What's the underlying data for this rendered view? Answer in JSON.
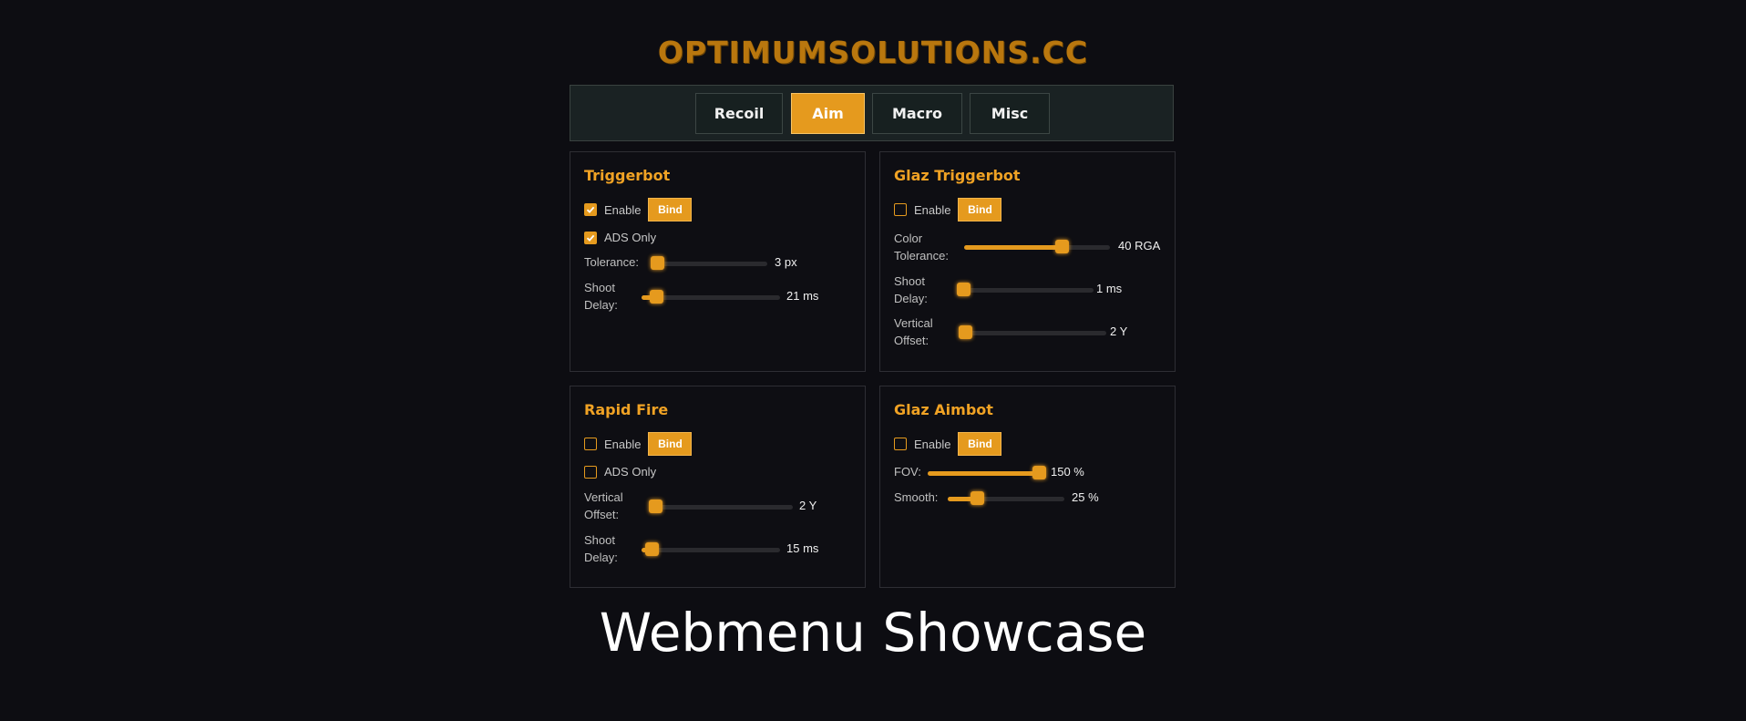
{
  "brand": "OPTIMUMSOLUTIONS.CC",
  "tabs": {
    "recoil": "Recoil",
    "aim": "Aim",
    "macro": "Macro",
    "misc": "Misc",
    "active": "Aim"
  },
  "triggerbot": {
    "title": "Triggerbot",
    "enable_label": "Enable",
    "enable_checked": true,
    "bind_label": "Bind",
    "ads_label": "ADS Only",
    "ads_checked": true,
    "tolerance": {
      "label": "Tolerance:",
      "value": 3,
      "max": 100,
      "display": "3 px"
    },
    "shoot_delay": {
      "label1": "Shoot",
      "label2": "Delay:",
      "value": 21,
      "max": 200,
      "display": "21 ms"
    }
  },
  "glaz_triggerbot": {
    "title": "Glaz Triggerbot",
    "enable_label": "Enable",
    "enable_checked": false,
    "bind_label": "Bind",
    "color_tolerance": {
      "label1": "Color",
      "label2": "Tolerance:",
      "value": 40,
      "max": 60,
      "display": "40 RGA"
    },
    "shoot_delay": {
      "label1": "Shoot",
      "label2": "Delay:",
      "value": 1,
      "max": 200,
      "display": "1 ms"
    },
    "vertical_offset": {
      "label1": "Vertical",
      "label2": "Offset:",
      "value": 2,
      "max": 50,
      "display": "2 Y"
    }
  },
  "rapid_fire": {
    "title": "Rapid Fire",
    "enable_label": "Enable",
    "enable_checked": false,
    "bind_label": "Bind",
    "ads_label": "ADS Only",
    "ads_checked": false,
    "vertical_offset": {
      "label1": "Vertical",
      "label2": "Offset:",
      "value": 2,
      "max": 50,
      "display": "2 Y"
    },
    "shoot_delay": {
      "label1": "Shoot",
      "label2": "Delay:",
      "value": 15,
      "max": 200,
      "display": "15 ms"
    }
  },
  "glaz_aimbot": {
    "title": "Glaz Aimbot",
    "enable_label": "Enable",
    "enable_checked": false,
    "bind_label": "Bind",
    "fov": {
      "label": "FOV:",
      "value": 150,
      "max": 150,
      "display": "150 %"
    },
    "smooth": {
      "label": "Smooth:",
      "value": 25,
      "max": 100,
      "display": "25 %"
    }
  },
  "caption": "Webmenu Showcase",
  "colors": {
    "accent": "#e59a1e",
    "background": "#0d0d12",
    "brand": "#b9770e"
  },
  "icons": {
    "checkbox_check": "check-icon"
  }
}
